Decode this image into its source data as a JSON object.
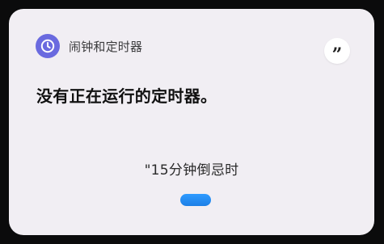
{
  "card": {
    "app_icon": "clock-icon",
    "app_name": "闹钟和定时器",
    "quote_icon": "quote-icon",
    "quote_glyph": "”",
    "message": "没有正在运行的定时器。",
    "suggestion": "\"15分钟倒忌时",
    "voice_indicator": "microphone-pill-icon"
  },
  "colors": {
    "background": "#0b0b0c",
    "card": "#f1eef3",
    "app_icon": "#6a6adf",
    "mic_pill": "#2f9bff"
  }
}
